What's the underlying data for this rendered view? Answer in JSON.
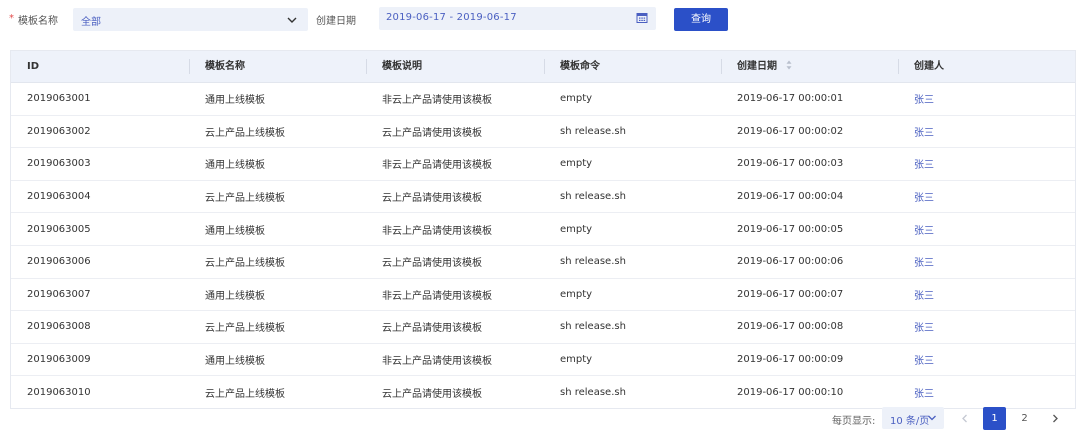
{
  "filters": {
    "required_mark": "*",
    "template_name_label": "模板名称",
    "template_name_value": "全部",
    "created_date_label": "创建日期",
    "created_date_value": "2019-06-17 - 2019-06-17",
    "query_button": "查询"
  },
  "table": {
    "columns": [
      "ID",
      "模板名称",
      "模板说明",
      "模板命令",
      "创建日期",
      "创建人"
    ],
    "rows": [
      [
        "2019063001",
        "通用上线模板",
        "非云上产品请使用该模板",
        "empty",
        "2019-06-17 00:00:01",
        "张三"
      ],
      [
        "2019063002",
        "云上产品上线模板",
        "云上产品请使用该模板",
        "sh release.sh",
        "2019-06-17 00:00:02",
        "张三"
      ],
      [
        "2019063003",
        "通用上线模板",
        "非云上产品请使用该模板",
        "empty",
        "2019-06-17 00:00:03",
        "张三"
      ],
      [
        "2019063004",
        "云上产品上线模板",
        "云上产品请使用该模板",
        "sh release.sh",
        "2019-06-17 00:00:04",
        "张三"
      ],
      [
        "2019063005",
        "通用上线模板",
        "非云上产品请使用该模板",
        "empty",
        "2019-06-17 00:00:05",
        "张三"
      ],
      [
        "2019063006",
        "云上产品上线模板",
        "云上产品请使用该模板",
        "sh release.sh",
        "2019-06-17 00:00:06",
        "张三"
      ],
      [
        "2019063007",
        "通用上线模板",
        "非云上产品请使用该模板",
        "empty",
        "2019-06-17 00:00:07",
        "张三"
      ],
      [
        "2019063008",
        "云上产品上线模板",
        "云上产品请使用该模板",
        "sh release.sh",
        "2019-06-17 00:00:08",
        "张三"
      ],
      [
        "2019063009",
        "通用上线模板",
        "非云上产品请使用该模板",
        "empty",
        "2019-06-17 00:00:09",
        "张三"
      ],
      [
        "2019063010",
        "云上产品上线模板",
        "云上产品请使用该模板",
        "sh release.sh",
        "2019-06-17 00:00:10",
        "张三"
      ]
    ]
  },
  "pagination": {
    "page_size_label": "每页显示:",
    "page_size_value": "10 条/页",
    "pages": [
      "1",
      "2"
    ],
    "current_page": "1"
  },
  "colors": {
    "accent": "#2b50c8",
    "link": "#4a5fc1",
    "input_bg": "#edf1f9",
    "header_bg": "#eef2fa",
    "required": "#e34c4c"
  },
  "icons": {
    "select_chevron": "chevron-down-icon",
    "calendar": "calendar-icon",
    "sort": "sort-icon",
    "prev": "chevron-left-icon",
    "next": "chevron-right-icon"
  }
}
